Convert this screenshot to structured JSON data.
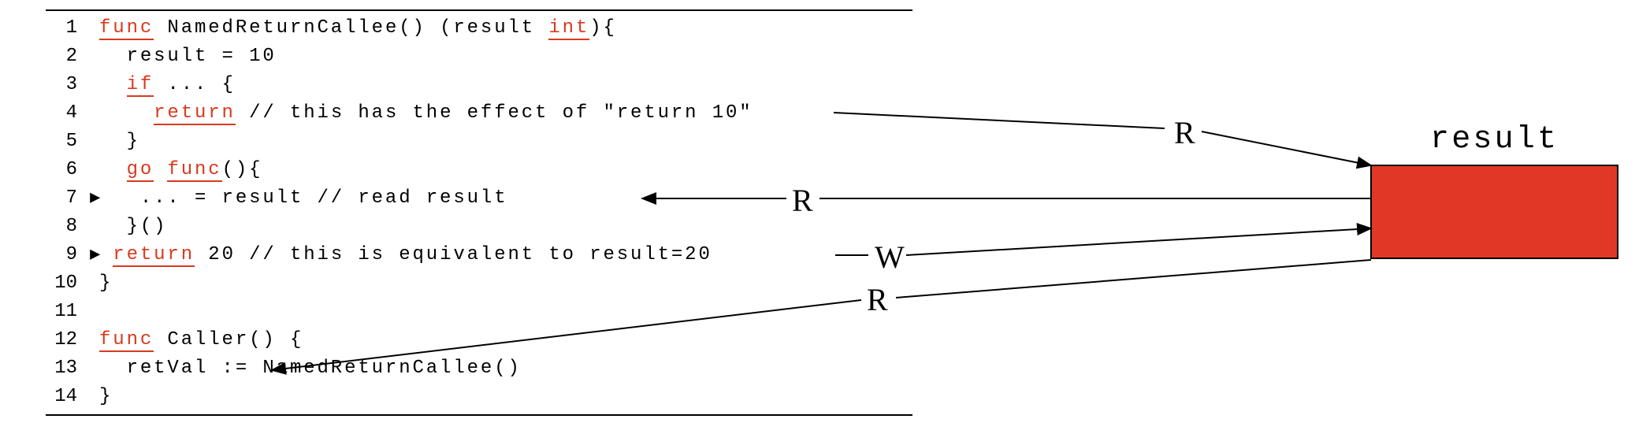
{
  "code": {
    "lines": [
      {
        "num": "1",
        "marker": "",
        "segments": [
          {
            "k": true,
            "t": "func"
          },
          {
            "k": false,
            "t": " NamedReturnCallee() (result "
          },
          {
            "k": true,
            "t": "int"
          },
          {
            "k": false,
            "t": "){"
          }
        ]
      },
      {
        "num": "2",
        "marker": "",
        "segments": [
          {
            "k": false,
            "t": "  result = 10"
          }
        ]
      },
      {
        "num": "3",
        "marker": "",
        "segments": [
          {
            "k": false,
            "t": "  "
          },
          {
            "k": true,
            "t": "if"
          },
          {
            "k": false,
            "t": " ... {"
          }
        ]
      },
      {
        "num": "4",
        "marker": "",
        "segments": [
          {
            "k": false,
            "t": "    "
          },
          {
            "k": true,
            "t": "return"
          },
          {
            "k": false,
            "t": " // this has the effect of \"return 10\""
          }
        ]
      },
      {
        "num": "5",
        "marker": "",
        "segments": [
          {
            "k": false,
            "t": "  }"
          }
        ]
      },
      {
        "num": "6",
        "marker": "",
        "segments": [
          {
            "k": false,
            "t": "  "
          },
          {
            "k": true,
            "t": "go"
          },
          {
            "k": false,
            "t": " "
          },
          {
            "k": true,
            "t": "func"
          },
          {
            "k": false,
            "t": "(){"
          }
        ]
      },
      {
        "num": "7",
        "marker": "▶",
        "segments": [
          {
            "k": false,
            "t": "   ... = result // read result"
          }
        ]
      },
      {
        "num": "8",
        "marker": "",
        "segments": [
          {
            "k": false,
            "t": "  }()"
          }
        ]
      },
      {
        "num": "9",
        "marker": "▶",
        "segments": [
          {
            "k": false,
            "t": " "
          },
          {
            "k": true,
            "t": "return"
          },
          {
            "k": false,
            "t": " 20 // this is equivalent to result=20"
          }
        ]
      },
      {
        "num": "10",
        "marker": "",
        "segments": [
          {
            "k": false,
            "t": "}"
          }
        ]
      },
      {
        "num": "11",
        "marker": "",
        "segments": [
          {
            "k": false,
            "t": ""
          }
        ]
      },
      {
        "num": "12",
        "marker": "",
        "segments": [
          {
            "k": true,
            "t": "func"
          },
          {
            "k": false,
            "t": " Caller() {"
          }
        ]
      },
      {
        "num": "13",
        "marker": "",
        "segments": [
          {
            "k": false,
            "t": "  retVal := NamedReturnCallee()"
          }
        ]
      },
      {
        "num": "14",
        "marker": "",
        "segments": [
          {
            "k": false,
            "t": "}"
          }
        ]
      }
    ]
  },
  "memory": {
    "label": "result"
  },
  "edges": {
    "r1": "R",
    "r2": "R",
    "w": "W",
    "r3": "R"
  }
}
